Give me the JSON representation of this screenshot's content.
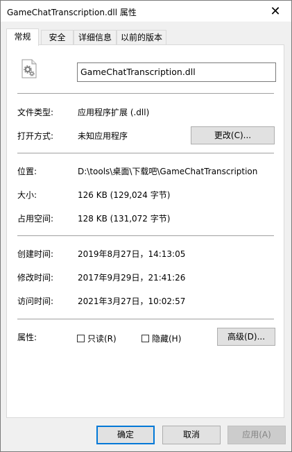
{
  "window": {
    "title": "GameChatTranscription.dll 属性",
    "close_glyph": "✕"
  },
  "tabs": [
    {
      "label": "常规",
      "active": true
    },
    {
      "label": "安全",
      "active": false
    },
    {
      "label": "详细信息",
      "active": false
    },
    {
      "label": "以前的版本",
      "active": false
    }
  ],
  "general": {
    "filename": "GameChatTranscription.dll",
    "file_type_label": "文件类型:",
    "file_type_value": "应用程序扩展 (.dll)",
    "open_with_label": "打开方式:",
    "open_with_value": "未知应用程序",
    "change_button": "更改(C)...",
    "location_label": "位置:",
    "location_value": "D:\\tools\\桌面\\下载吧\\GameChatTranscription",
    "size_label": "大小:",
    "size_value": "126 KB (129,024 字节)",
    "size_on_disk_label": "占用空间:",
    "size_on_disk_value": "128 KB (131,072 字节)",
    "created_label": "创建时间:",
    "created_value": "2019年8月27日，14:13:05",
    "modified_label": "修改时间:",
    "modified_value": "2017年9月29日，21:41:26",
    "accessed_label": "访问时间:",
    "accessed_value": "2021年3月27日，10:02:57",
    "attributes_label": "属性:",
    "readonly_label": "只读(R)",
    "readonly_checked": false,
    "hidden_label": "隐藏(H)",
    "hidden_checked": false,
    "advanced_button": "高级(D)..."
  },
  "footer": {
    "ok": "确定",
    "cancel": "取消",
    "apply": "应用(A)"
  },
  "colors": {
    "accent": "#0078d7"
  },
  "icons": {
    "file_icon": "dll-gear-file-icon",
    "close_icon": "close-icon"
  }
}
